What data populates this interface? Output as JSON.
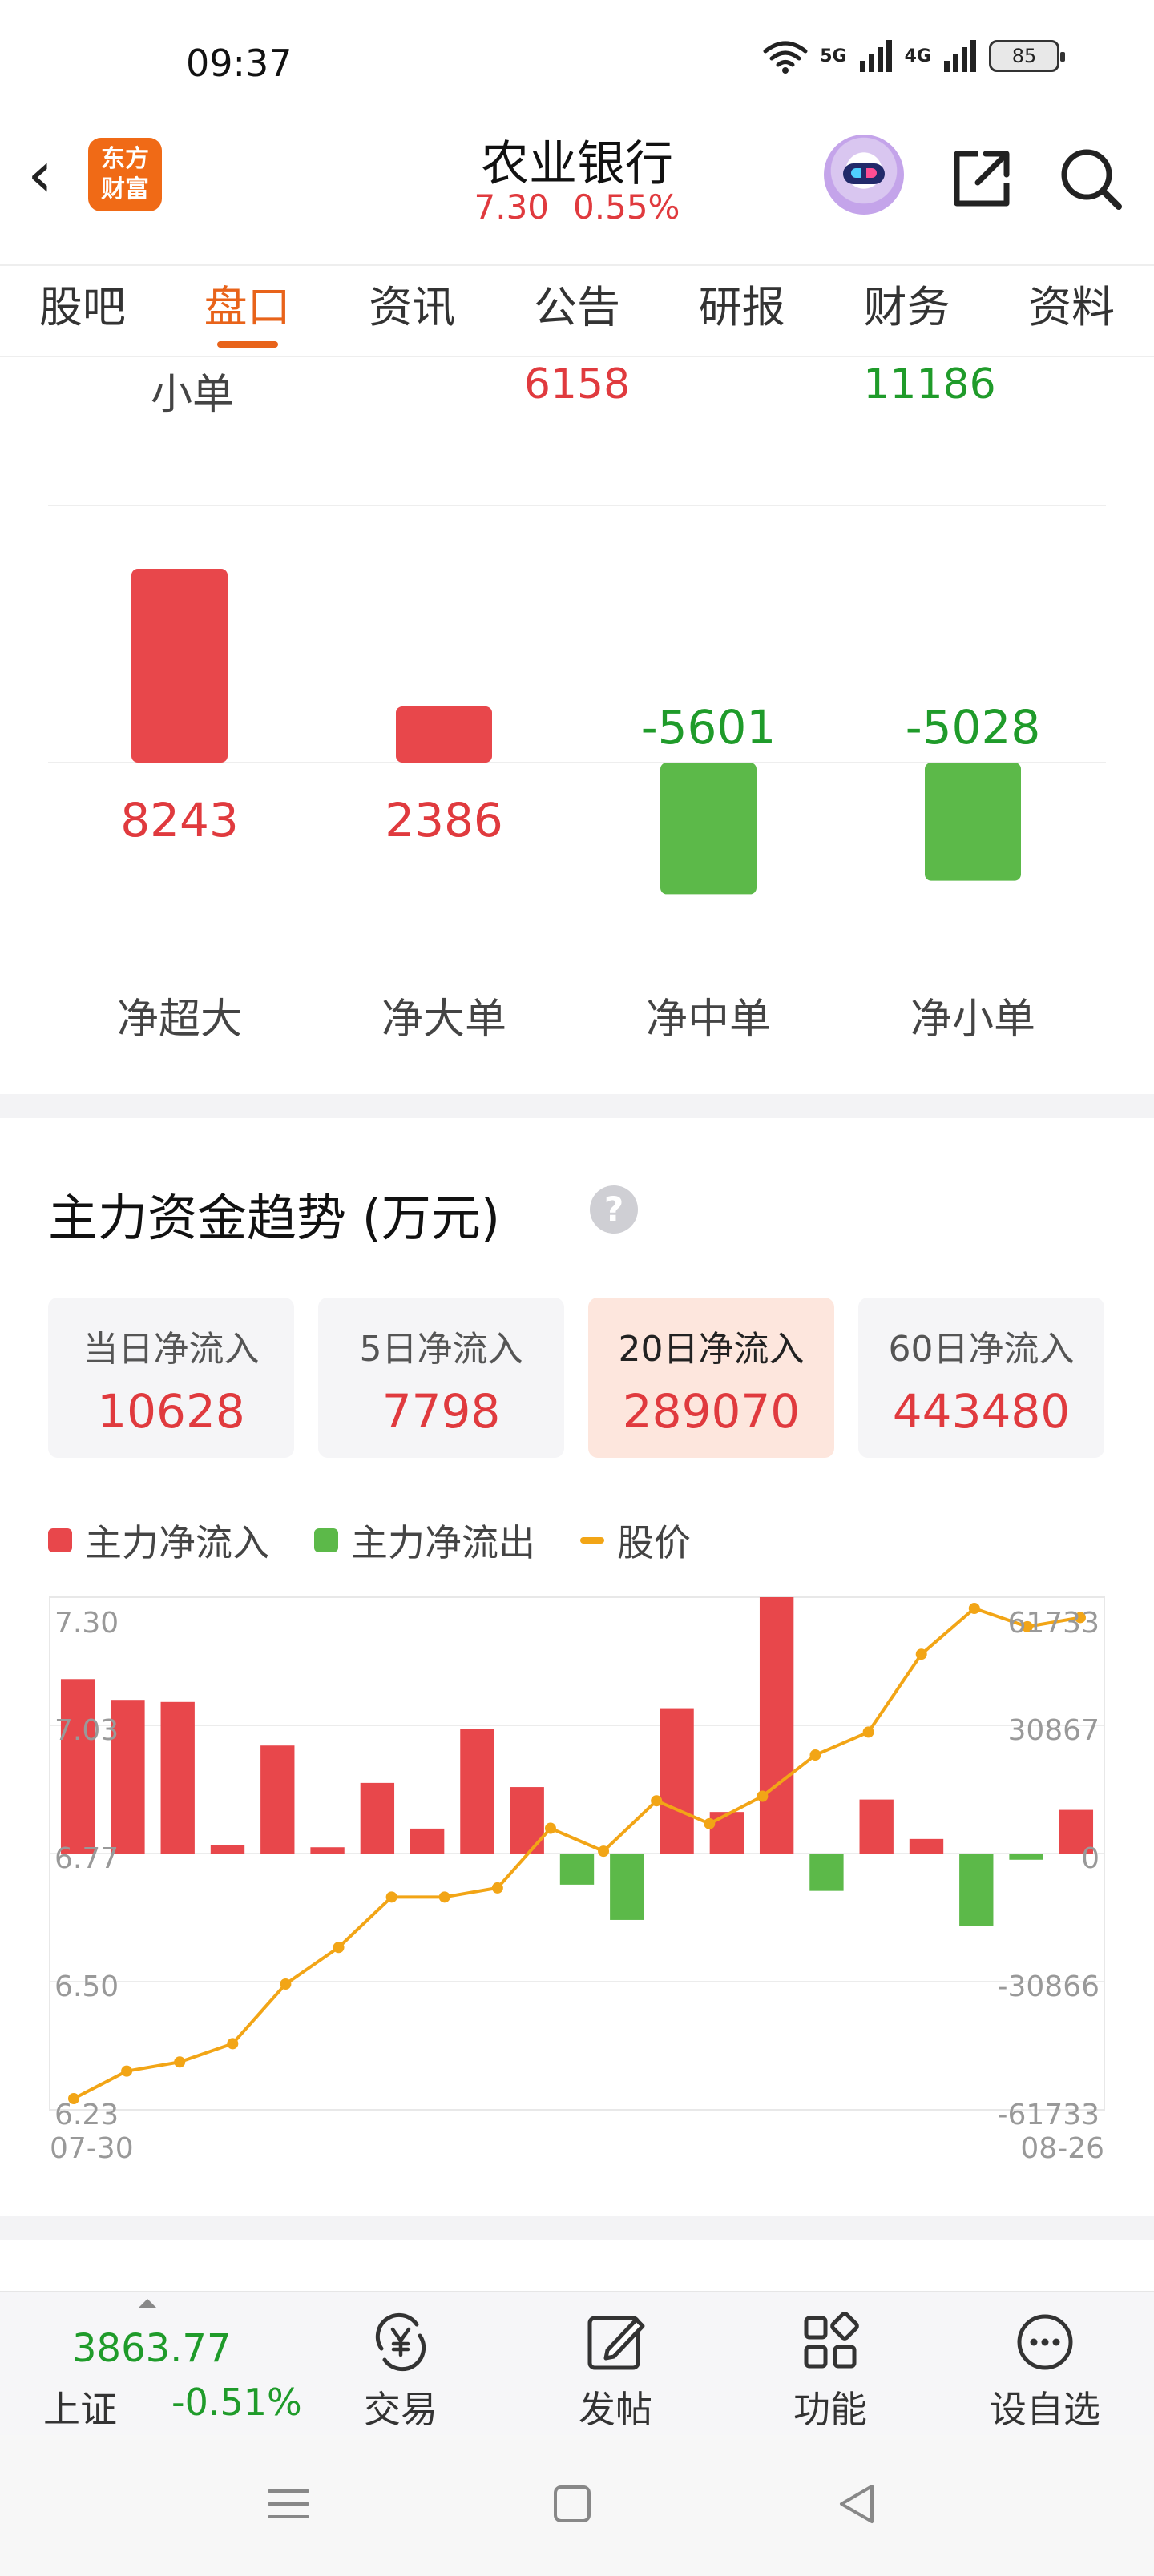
{
  "status_bar": {
    "time": "09:37",
    "net1": "5G",
    "net2": "4G",
    "battery": "85"
  },
  "header": {
    "back": "‹",
    "logo_line1": "东方",
    "logo_line2": "财富",
    "title": "农业银行",
    "price": "7.30",
    "change_pct": "0.55%"
  },
  "tabs": [
    {
      "label": "股吧",
      "active": false
    },
    {
      "label": "盘口",
      "active": true
    },
    {
      "label": "资讯",
      "active": false
    },
    {
      "label": "公告",
      "active": false
    },
    {
      "label": "研报",
      "active": false
    },
    {
      "label": "财务",
      "active": false
    },
    {
      "label": "资料",
      "active": false
    }
  ],
  "small_order_row": {
    "label": "小单",
    "inflow": "6158",
    "outflow": "11186"
  },
  "net_flow_chart": {
    "categories": [
      "净超大",
      "净大单",
      "净中单",
      "净小单"
    ],
    "values": [
      8243,
      2386,
      -5601,
      -5028
    ],
    "value_labels": [
      "8243",
      "2386",
      "-5601",
      "-5028"
    ],
    "colors": {
      "positive": "#e8474b",
      "negative": "#5cb949"
    }
  },
  "trend_section": {
    "title": "主力资金趋势 (万元)",
    "help_icon": "?",
    "cards": [
      {
        "label": "当日净流入",
        "value": "10628",
        "active": false
      },
      {
        "label": "5日净流入",
        "value": "7798",
        "active": false
      },
      {
        "label": "20日净流入",
        "value": "289070",
        "active": true
      },
      {
        "label": "60日净流入",
        "value": "443480",
        "active": false
      }
    ],
    "legend": [
      {
        "label": "主力净流入",
        "color": "#e8474b",
        "kind": "box"
      },
      {
        "label": "主力净流出",
        "color": "#5cb949",
        "kind": "box"
      },
      {
        "label": "股价",
        "color": "#f2a516",
        "kind": "line"
      }
    ]
  },
  "chart_data": {
    "type": "bar",
    "x_start_label": "07-30",
    "x_end_label": "08-26",
    "left_axis_ticks": [
      "7.30",
      "7.03",
      "6.77",
      "6.50",
      "6.23"
    ],
    "right_axis_ticks": [
      "61733",
      "30867",
      "0",
      "-30866",
      "-61733"
    ],
    "ylim_flow": [
      -61733,
      61733
    ],
    "ylim_price": [
      6.23,
      7.3
    ],
    "series": [
      {
        "name": "主力净流入/主力净流出",
        "values": [
          42000,
          37000,
          36500,
          2000,
          26000,
          1500,
          17000,
          6000,
          30000,
          16000,
          -7500,
          -16000,
          35000,
          10000,
          61733,
          -9000,
          13000,
          3500,
          -17500,
          -1500,
          10500
        ]
      },
      {
        "name": "股价",
        "values": [
          6.23,
          6.29,
          6.31,
          6.35,
          6.48,
          6.56,
          6.67,
          6.67,
          6.69,
          6.82,
          6.77,
          6.88,
          6.83,
          6.89,
          6.98,
          7.03,
          7.2,
          7.3,
          7.26,
          7.28
        ]
      }
    ]
  },
  "bottom_bar": {
    "index_value": "3863.77",
    "index_name": "上证",
    "index_pct": "-0.51%",
    "items": [
      {
        "label": "交易",
        "icon": "yen-exchange-icon"
      },
      {
        "label": "发帖",
        "icon": "edit-post-icon"
      },
      {
        "label": "功能",
        "icon": "grid-functions-icon"
      },
      {
        "label": "设自选",
        "icon": "more-dots-icon"
      }
    ]
  }
}
